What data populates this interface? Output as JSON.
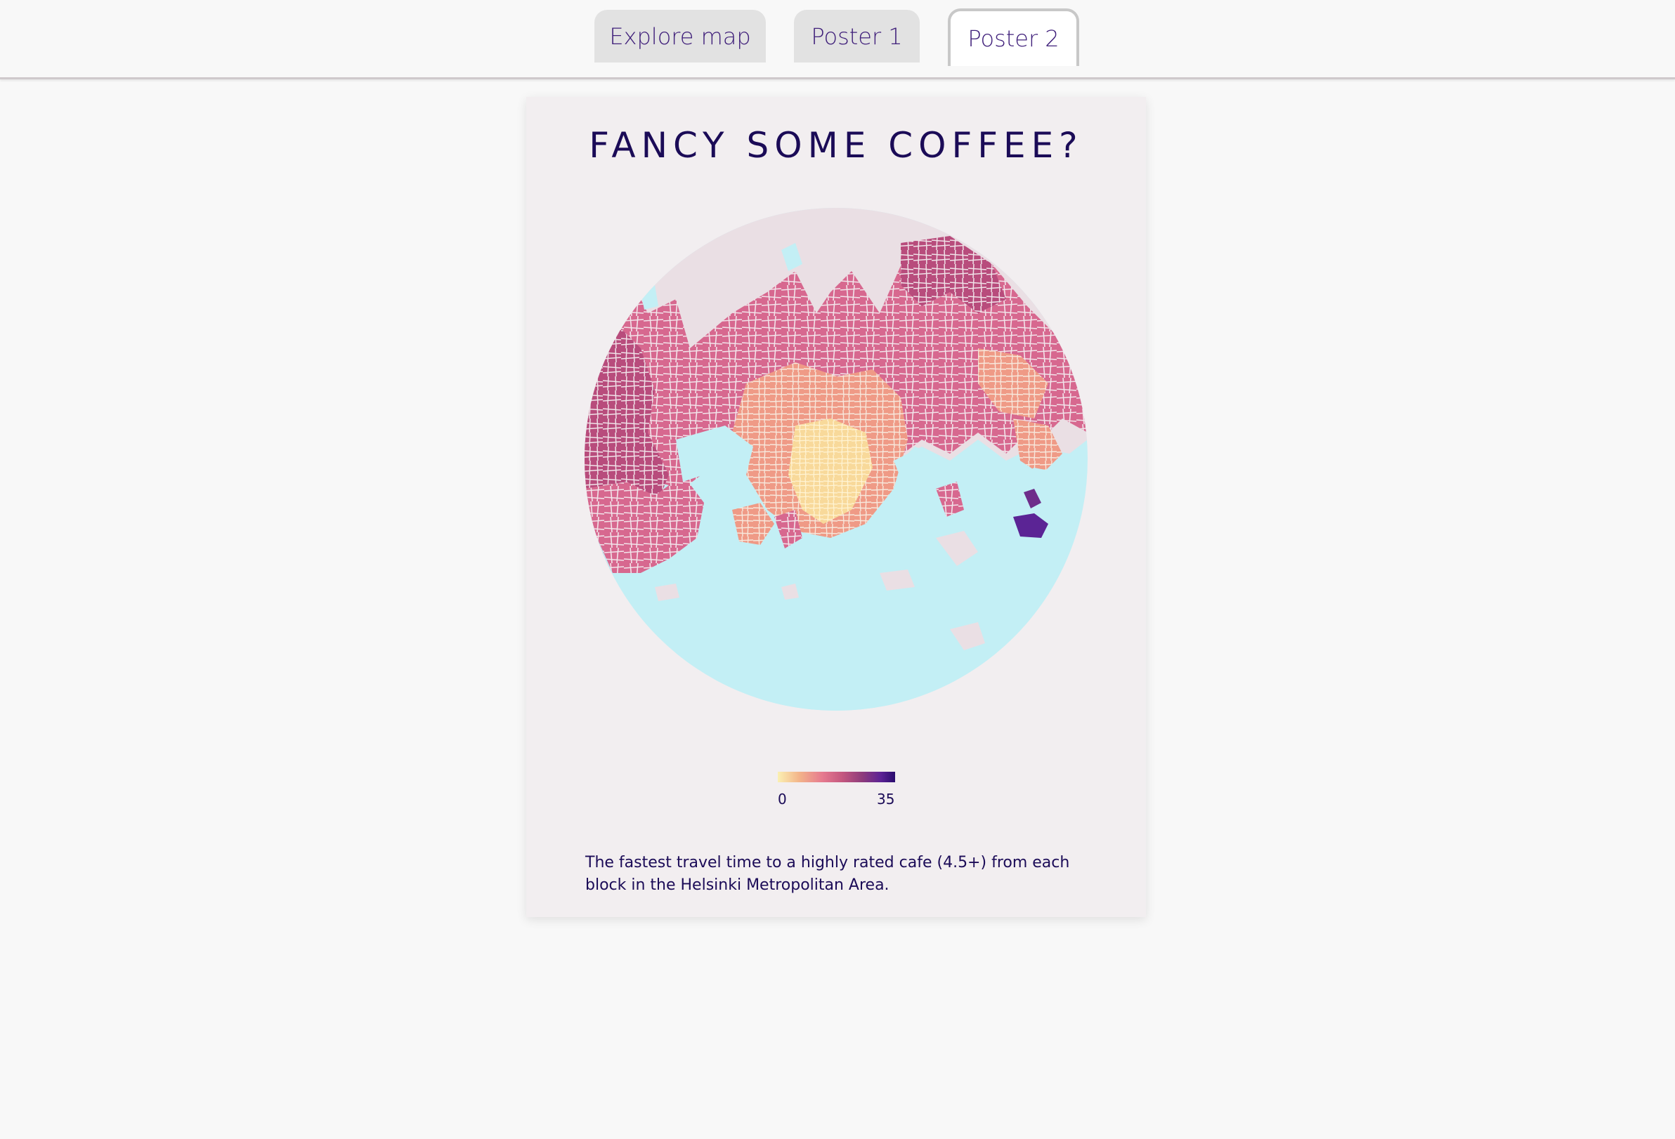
{
  "tabs": [
    {
      "label": "Explore map",
      "active": false
    },
    {
      "label": "Poster 1",
      "active": false
    },
    {
      "label": "Poster 2",
      "active": true
    }
  ],
  "poster": {
    "title": "FANCY SOME COFFEE?",
    "legend": {
      "min_label": "0",
      "max_label": "35"
    },
    "caption": "The fastest travel time to a highly rated cafe (4.5+) from each block in the Helsinki Metropolitan Area."
  },
  "colors": {
    "title_text": "#1b0b57",
    "tab_text": "#3f1f7a",
    "sea": "#c3eff5",
    "land": "#eadfe4",
    "scale_low": "#fbf0b2",
    "scale_mid": "#e67a8f",
    "scale_high": "#2a0b6e"
  }
}
